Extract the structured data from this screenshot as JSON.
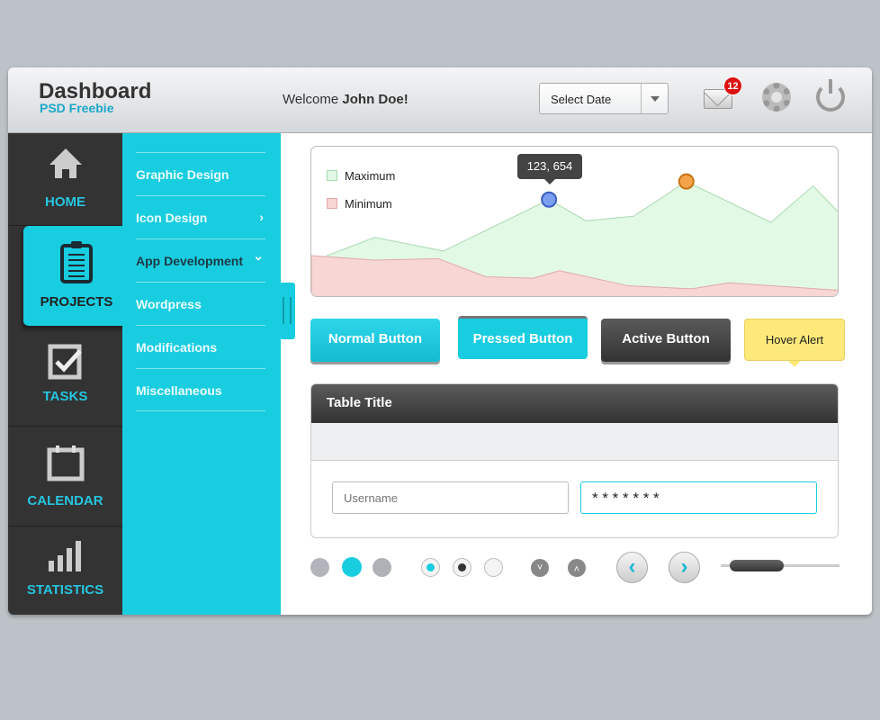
{
  "header": {
    "title": "Dashboard",
    "subtitle": "PSD Freebie",
    "welcome_prefix": "Welcome ",
    "user_name": "John Doe!",
    "select_date": "Select Date",
    "mail_count": "12"
  },
  "sidebar": {
    "items": [
      {
        "label": "HOME",
        "icon": "home-icon"
      },
      {
        "label": "PROJECTS",
        "icon": "clipboard-icon",
        "active": true
      },
      {
        "label": "TASKS",
        "icon": "checkbox-icon"
      },
      {
        "label": "CALENDAR",
        "icon": "calendar-icon"
      },
      {
        "label": "STATISTICS",
        "icon": "bar-chart-icon"
      }
    ]
  },
  "submenu": {
    "items": [
      {
        "label": "Graphic Design"
      },
      {
        "label": "Icon Design",
        "chevron": "›"
      },
      {
        "label": "App Development",
        "chevron": "⌄",
        "active": true
      },
      {
        "label": "Wordpress"
      },
      {
        "label": "Modifications"
      },
      {
        "label": "Miscellaneous"
      }
    ]
  },
  "chart_data": {
    "type": "area",
    "tooltip": "123, 654",
    "legend_position": "top-left",
    "grid": false,
    "series": [
      {
        "name": "Maximum",
        "color": "#e2f9e6",
        "x": [
          3,
          12,
          25,
          45,
          52,
          61,
          71,
          87,
          95,
          100
        ],
        "values": [
          28,
          40,
          31,
          65,
          51,
          54,
          77,
          50,
          74,
          56
        ]
      },
      {
        "name": "Minimum",
        "color": "#f7d6d4",
        "x": [
          0,
          12,
          24,
          33,
          42,
          47,
          60,
          72,
          79,
          100
        ],
        "values": [
          28,
          25,
          26,
          14,
          13,
          18,
          8,
          6,
          10,
          5
        ]
      }
    ]
  },
  "buttons": {
    "normal": "Normal Button",
    "pressed": "Pressed Button",
    "active": "Active Button",
    "hover": "Hover Alert"
  },
  "table": {
    "title": "Table Title",
    "username_placeholder": "Username",
    "password_value": "* * * * * * *"
  },
  "colors": {
    "accent": "#19cde0",
    "dark": "#333333",
    "alert": "#fce97a"
  }
}
